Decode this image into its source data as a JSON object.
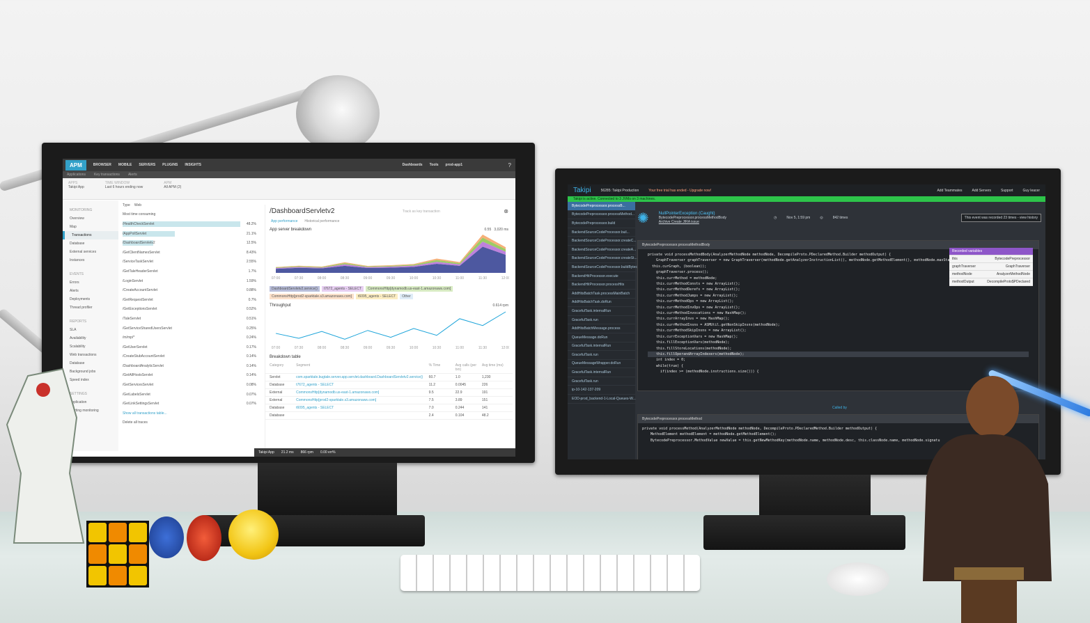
{
  "newrelic": {
    "logo": "APM",
    "nav": [
      "BROWSER",
      "MOBILE",
      "SERVERS",
      "PLUGINS",
      "INSIGHTS"
    ],
    "top_right": [
      "Dashboards",
      "Tools",
      "prod-app1"
    ],
    "subnav": [
      "Applications",
      "Key transactions",
      "Alerts"
    ],
    "context": {
      "app_label": "APPS",
      "app": "Takipi App",
      "time_label": "TIME WINDOW",
      "time": "Last 6 hours ending now",
      "apm_label": "APM",
      "apm": "All APM (2)"
    },
    "sidebar": {
      "monitoring_header": "MONITORING",
      "monitoring": [
        "Overview",
        "Map",
        "Transactions",
        "Database",
        "External services",
        "Instances"
      ],
      "events_header": "EVENTS",
      "events": [
        "Errors",
        "Alerts",
        "Deployments",
        "Thread profiler"
      ],
      "reports_header": "REPORTS",
      "reports": [
        "SLA",
        "Availability",
        "Scalability",
        "Web transactions",
        "Database",
        "Background jobs",
        "Speed index"
      ],
      "settings_header": "SETTINGS",
      "settings": [
        "Application",
        "Alerting monitoring"
      ]
    },
    "filter": {
      "type_label": "Type",
      "type_value": "Web",
      "sort_value": "Most time consuming"
    },
    "transactions": [
      {
        "name": "/HealthCheckServlet",
        "pct": "48.2%",
        "bar": 0.95
      },
      {
        "name": "/AppPollServlet",
        "pct": "21.1%",
        "bar": 0.42
      },
      {
        "name": "/DashboardServletv2",
        "pct": "12.5%",
        "bar": 0.25
      },
      {
        "name": "/GetClientNamesServlet",
        "pct": "8.43%",
        "bar": 0
      },
      {
        "name": "/ServiceTaskServlet",
        "pct": "2.55%",
        "bar": 0
      },
      {
        "name": "/GetTaleHeaderServlet",
        "pct": "1.7%",
        "bar": 0
      },
      {
        "name": "/LoginServlet",
        "pct": "1.59%",
        "bar": 0
      },
      {
        "name": "/CreateAccountServlet",
        "pct": "0.88%",
        "bar": 0
      },
      {
        "name": "/GetRequestServlet",
        "pct": "0.7%",
        "bar": 0
      },
      {
        "name": "/GetExceptionsServlet",
        "pct": "0.52%",
        "bar": 0
      },
      {
        "name": "/TaleServlet",
        "pct": "0.51%",
        "bar": 0
      },
      {
        "name": "/GetServiceSharedUsersServlet",
        "pct": "0.25%",
        "bar": 0
      },
      {
        "name": "/m/mp/*",
        "pct": "0.24%",
        "bar": 0
      },
      {
        "name": "/GetUserServlet",
        "pct": "0.17%",
        "bar": 0
      },
      {
        "name": "/CreateStubAccountServlet",
        "pct": "0.14%",
        "bar": 0
      },
      {
        "name": "/DashboardAnalyticServlet",
        "pct": "0.14%",
        "bar": 0
      },
      {
        "name": "/GetAllHostsServlet",
        "pct": "0.14%",
        "bar": 0
      },
      {
        "name": "/GetServicesServlet",
        "pct": "0.08%",
        "bar": 0
      },
      {
        "name": "/GetLabelsServlet",
        "pct": "0.07%",
        "bar": 0
      },
      {
        "name": "/GetLinkSettingsServlet",
        "pct": "0.07%",
        "bar": 0
      }
    ],
    "show_all": "Show all transactions table...",
    "delete_traces": "Delete all traces",
    "detail": {
      "title": "/DashboardServletv2",
      "track": "Track as key transaction",
      "tabs": [
        "App performance",
        "Historical performance"
      ],
      "breakdown_title": "App server breakdown",
      "apdex": "0.55",
      "avg": "3,020 ms",
      "throughput_title": "Throughput",
      "throughput_value": "0.614 rpm",
      "legend": [
        "DashboardServletv2.service()",
        "t7672_agents - SELECT",
        "CommonsHttp[dynamodb.us-east-1.amazonaws.com]",
        "CommonsHttp[prod2-sparktale.s3.amazonaws.com]",
        "t6095_agents - SELECT",
        "Other"
      ],
      "table_title": "Breakdown table",
      "table_headers": [
        "Category",
        "Segment",
        "% Time",
        "Avg calls (per txn)",
        "Avg time (ms)"
      ],
      "table_rows": [
        [
          "Servlet",
          "com.sparktale.bugtale.server.app.servlet.dashboard.DashboardServletv2.service()",
          "60.7",
          "1.0",
          "1,230"
        ],
        [
          "Database",
          "t7672_agents - SELECT",
          "11.2",
          "0.0045",
          "226"
        ],
        [
          "External",
          "CommonsHttp[dynamodb.us-east-1.amazonaws.com]",
          "9.5",
          "22.9",
          "191"
        ],
        [
          "External",
          "CommonsHttp[prod2-sparktale.s3.amazonaws.com]",
          "7.5",
          "3.89",
          "151"
        ],
        [
          "Database",
          "t6095_agents - SELECT",
          "7.0",
          "0.244",
          "141"
        ],
        [
          "Database",
          "",
          "2.4",
          "0.104",
          "48.2"
        ]
      ]
    },
    "footer": {
      "app": "Takipi App",
      "rt": "21.2 ms",
      "tp": "866 rpm",
      "err": "0.00 err%"
    },
    "chart_data": [
      {
        "type": "area",
        "title": "App server breakdown",
        "x": [
          "07:00",
          "07:30",
          "08:00",
          "08:30",
          "09:00",
          "09:30",
          "10:00",
          "10:30",
          "11:00",
          "11:30",
          "12:00"
        ],
        "ylabel": "ms",
        "series": [
          {
            "name": "DashboardServletv2.service()",
            "values": [
              400,
              500,
              450,
              700,
              480,
              520,
              600,
              900,
              700,
              2600,
              1800
            ]
          },
          {
            "name": "t7672_agents - SELECT",
            "values": [
              80,
              90,
              70,
              150,
              90,
              100,
              120,
              200,
              150,
              500,
              300
            ]
          },
          {
            "name": "CommonsHttp[dynamodb.us-east-1.amazonaws.com]",
            "values": [
              60,
              70,
              60,
              120,
              70,
              80,
              90,
              180,
              120,
              400,
              250
            ]
          },
          {
            "name": "CommonsHttp[prod2-sparktale.s3.amazonaws.com]",
            "values": [
              40,
              50,
              40,
              80,
              50,
              60,
              70,
              140,
              100,
              300,
              200
            ]
          }
        ]
      },
      {
        "type": "line",
        "title": "Throughput",
        "x": [
          "07:00",
          "07:30",
          "08:00",
          "08:30",
          "09:00",
          "09:30",
          "10:00",
          "10:30",
          "11:00",
          "11:30",
          "12:00"
        ],
        "ylabel": "rpm",
        "series": [
          {
            "name": "Throughput",
            "values": [
              1,
              0.5,
              1.2,
              0.4,
              1.3,
              0.6,
              1.5,
              0.8,
              2.5,
              1.8,
              3.2
            ]
          }
        ]
      }
    ]
  },
  "takipi": {
    "brand": "Takipi",
    "env": "56285: Takipi Production",
    "trial": "Your free trial has ended - Upgrade now!",
    "top_actions": [
      "Add Teammates",
      "Add Servers",
      "Support",
      "Guy Ieacer"
    ],
    "green_bar": "Takipi is active. Connected to 3 JVMs on 3 machines.",
    "sidebar": [
      "BytecodePreprocessor.processB...",
      "BytecodePreprocessor.processMethod...",
      "BytecodePreprocessor.build",
      "BackendSourceCodeProcessor.buil...",
      "BackendSourceCodeProcessor.createC...",
      "BackendSourceCodeProcessor.createA...",
      "BackendSourceCodeProcessor.createSt...",
      "BackendSourceCodeProcessor.buildBytecodePre...",
      "BackendHitProcessor.execute",
      "BackendHitProcessor.processHits",
      "AddHitsBatchTask.processMainBatch",
      "AddHitsBatchTask.doRun",
      "GracefulTask.internalRun",
      "GracefulTask.run",
      "AddHitsBatchMessage.process",
      "QueueMessage.doRun",
      "GracefulTask.internalRun",
      "GracefulTask.run",
      "QueueMessageWrapper.doRun",
      "GracefulTask.internalRun",
      "GracefulTask.run",
      "ip-10-142-137-209",
      "EOD-prod_backend-1-Local-Queues-W..."
    ],
    "error_title": "NullPointerException (Caught)",
    "error_method": "BytecodePreprocessor.processMethodBody",
    "error_links": "Archive  Create JIRA issue",
    "date": "Nov 5, 1:59 pm",
    "times": "842 times",
    "recorded": "This event was recorded 23 times - view history",
    "fn1": "BytecodePreprocessor.processMethodBody",
    "code1": [
      "private void processMethodBody(AnalyzerMethodNode methodNode, DecompileProto.PDeclaredMethod.Builder methodOutput) {",
      "    GraphTraverser graphTraverser = new GraphTraverser(methodNode.getAnalyzerInstructionList(), methodNode.getMethodElement(), methodNode.maxStack,",
      "  this.curGraph, (boolean));",
      "    graphTraverser.process();",
      "    this.currMethod = methodNode;",
      "    this.currMethodConsts = new ArrayList();",
      "    this.currMethodDerefs = new ArrayList();",
      "    this.currMethodJumps = new ArrayList();",
      "    this.currMethodOps = new ArrayList();",
      "    this.currMethodInvOps = new ArrayList();",
      "    this.currMethodInvocations = new HashMap();",
      "    this.currArrayInvs = new HashMap();",
      "    this.currMethodInsns = ASMUtil.getNonSkipInsns(methodNode);",
      "    this.currMethodSkipInsns = new ArrayList();",
      "    this.currExceptionVars = new HashMap();",
      "    this.fillExceptionVars(methodNode);",
      "    this.fillStoreLocations(methodNode);",
      "    this.fillOperandArrayIndexers(methodNode);",
      "    int index = 0;",
      "",
      "    while(true) {",
      "      if(index >= (methodNode.instructions.size())) {"
    ],
    "vars_title": "Recorded variables",
    "vars": [
      [
        "this",
        "BytecodePreprocessor"
      ],
      [
        "graphTraverser",
        "GraphTraverser"
      ],
      [
        "methodNode",
        "AnalyzerMethodNode"
      ],
      [
        "methodOutput",
        "DecompileProto$PDeclared"
      ]
    ],
    "called_by": "Called by",
    "fn2": "BytecodePreprocessor.processMethod",
    "code2": [
      "private void processMethod(AnalyzerMethodNode methodNode, DecompileProto.PDeclaredMethod.Builder methodOutput) {",
      "    MethodElement methodElement = methodNode.getMethodElement();",
      "    BytecodePreprocessor.MethodValue newValue = this.getNewMethodKey(methodNode.name, methodNode.desc, this.classNode.name, methodNode.signatu"
    ]
  }
}
